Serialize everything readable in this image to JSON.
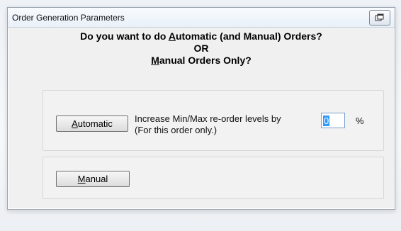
{
  "window": {
    "title": "Order Generation Parameters",
    "restore_icon": "restore-window-icon"
  },
  "prompt": {
    "line1_before": "Do you want to do ",
    "line1_underlined": "A",
    "line1_after": "utomatic (and Manual) Orders?",
    "line2": "OR",
    "line3_underlined": "M",
    "line3_after": "anual Orders Only?"
  },
  "automatic": {
    "button_underlined": "A",
    "button_rest": "utomatic",
    "description_line1": "Increase Min/Max re-order levels by",
    "description_line2": "(For this order only.)",
    "increase_value": "0",
    "unit": "%"
  },
  "manual": {
    "button_underlined": "M",
    "button_rest": "anual"
  },
  "colors": {
    "accent": "#3399ff"
  }
}
